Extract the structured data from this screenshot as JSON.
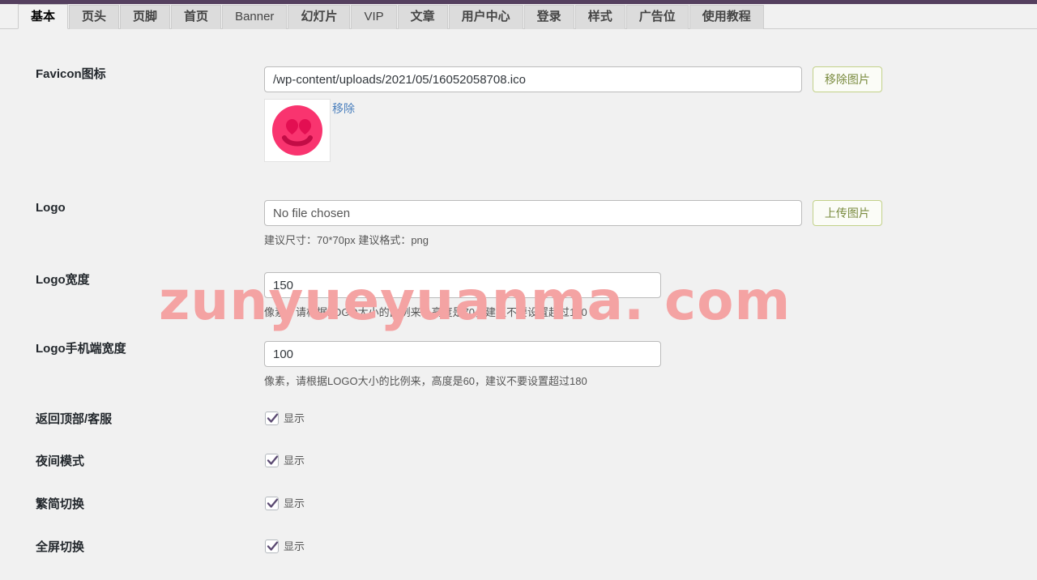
{
  "theme": {
    "top_bar_color": "#55405f",
    "page_bg": "#f1f1f1",
    "accent_green": "#c2d189",
    "link_blue": "#4a7fbd",
    "checkbox_check": "#5b4a72",
    "watermark_color": "#f4a3a3"
  },
  "tabs": [
    {
      "label": "基本",
      "active": true,
      "latin": false
    },
    {
      "label": "页头",
      "active": false,
      "latin": false
    },
    {
      "label": "页脚",
      "active": false,
      "latin": false
    },
    {
      "label": "首页",
      "active": false,
      "latin": false
    },
    {
      "label": "Banner",
      "active": false,
      "latin": true
    },
    {
      "label": "幻灯片",
      "active": false,
      "latin": false
    },
    {
      "label": "VIP",
      "active": false,
      "latin": true
    },
    {
      "label": "文章",
      "active": false,
      "latin": false
    },
    {
      "label": "用户中心",
      "active": false,
      "latin": false
    },
    {
      "label": "登录",
      "active": false,
      "latin": false
    },
    {
      "label": "样式",
      "active": false,
      "latin": false
    },
    {
      "label": "广告位",
      "active": false,
      "latin": false
    },
    {
      "label": "使用教程",
      "active": false,
      "latin": false
    }
  ],
  "watermark": {
    "text": "zunyueyuanma. com"
  },
  "rows": {
    "favicon": {
      "label": "Favicon图标",
      "value": "/wp-content/uploads/2021/05/16052058708.ico",
      "placeholder": "",
      "button": "移除图片",
      "remove_link": "移除"
    },
    "logo": {
      "label": "Logo",
      "value": "",
      "placeholder": "No file chosen",
      "button": "上传图片",
      "hint": "建议尺寸：70*70px 建议格式：png"
    },
    "logo_width": {
      "label": "Logo宽度",
      "value": "150",
      "hint": "像素，请根据LOGO大小的比例来，高度是70，建议不要设置超过180"
    },
    "logo_mobile_width": {
      "label": "Logo手机端宽度",
      "value": "100",
      "hint": "像素，请根据LOGO大小的比例来，高度是60，建议不要设置超过180"
    },
    "back_to_top": {
      "label": "返回顶部/客服",
      "checkbox_label": "显示",
      "checked": true
    },
    "night_mode": {
      "label": "夜间模式",
      "checkbox_label": "显示",
      "checked": true
    },
    "trad_simp_switch": {
      "label": "繁简切换",
      "checkbox_label": "显示",
      "checked": true
    },
    "fullscreen_switch": {
      "label": "全屏切换",
      "checkbox_label": "显示",
      "checked": true
    }
  }
}
